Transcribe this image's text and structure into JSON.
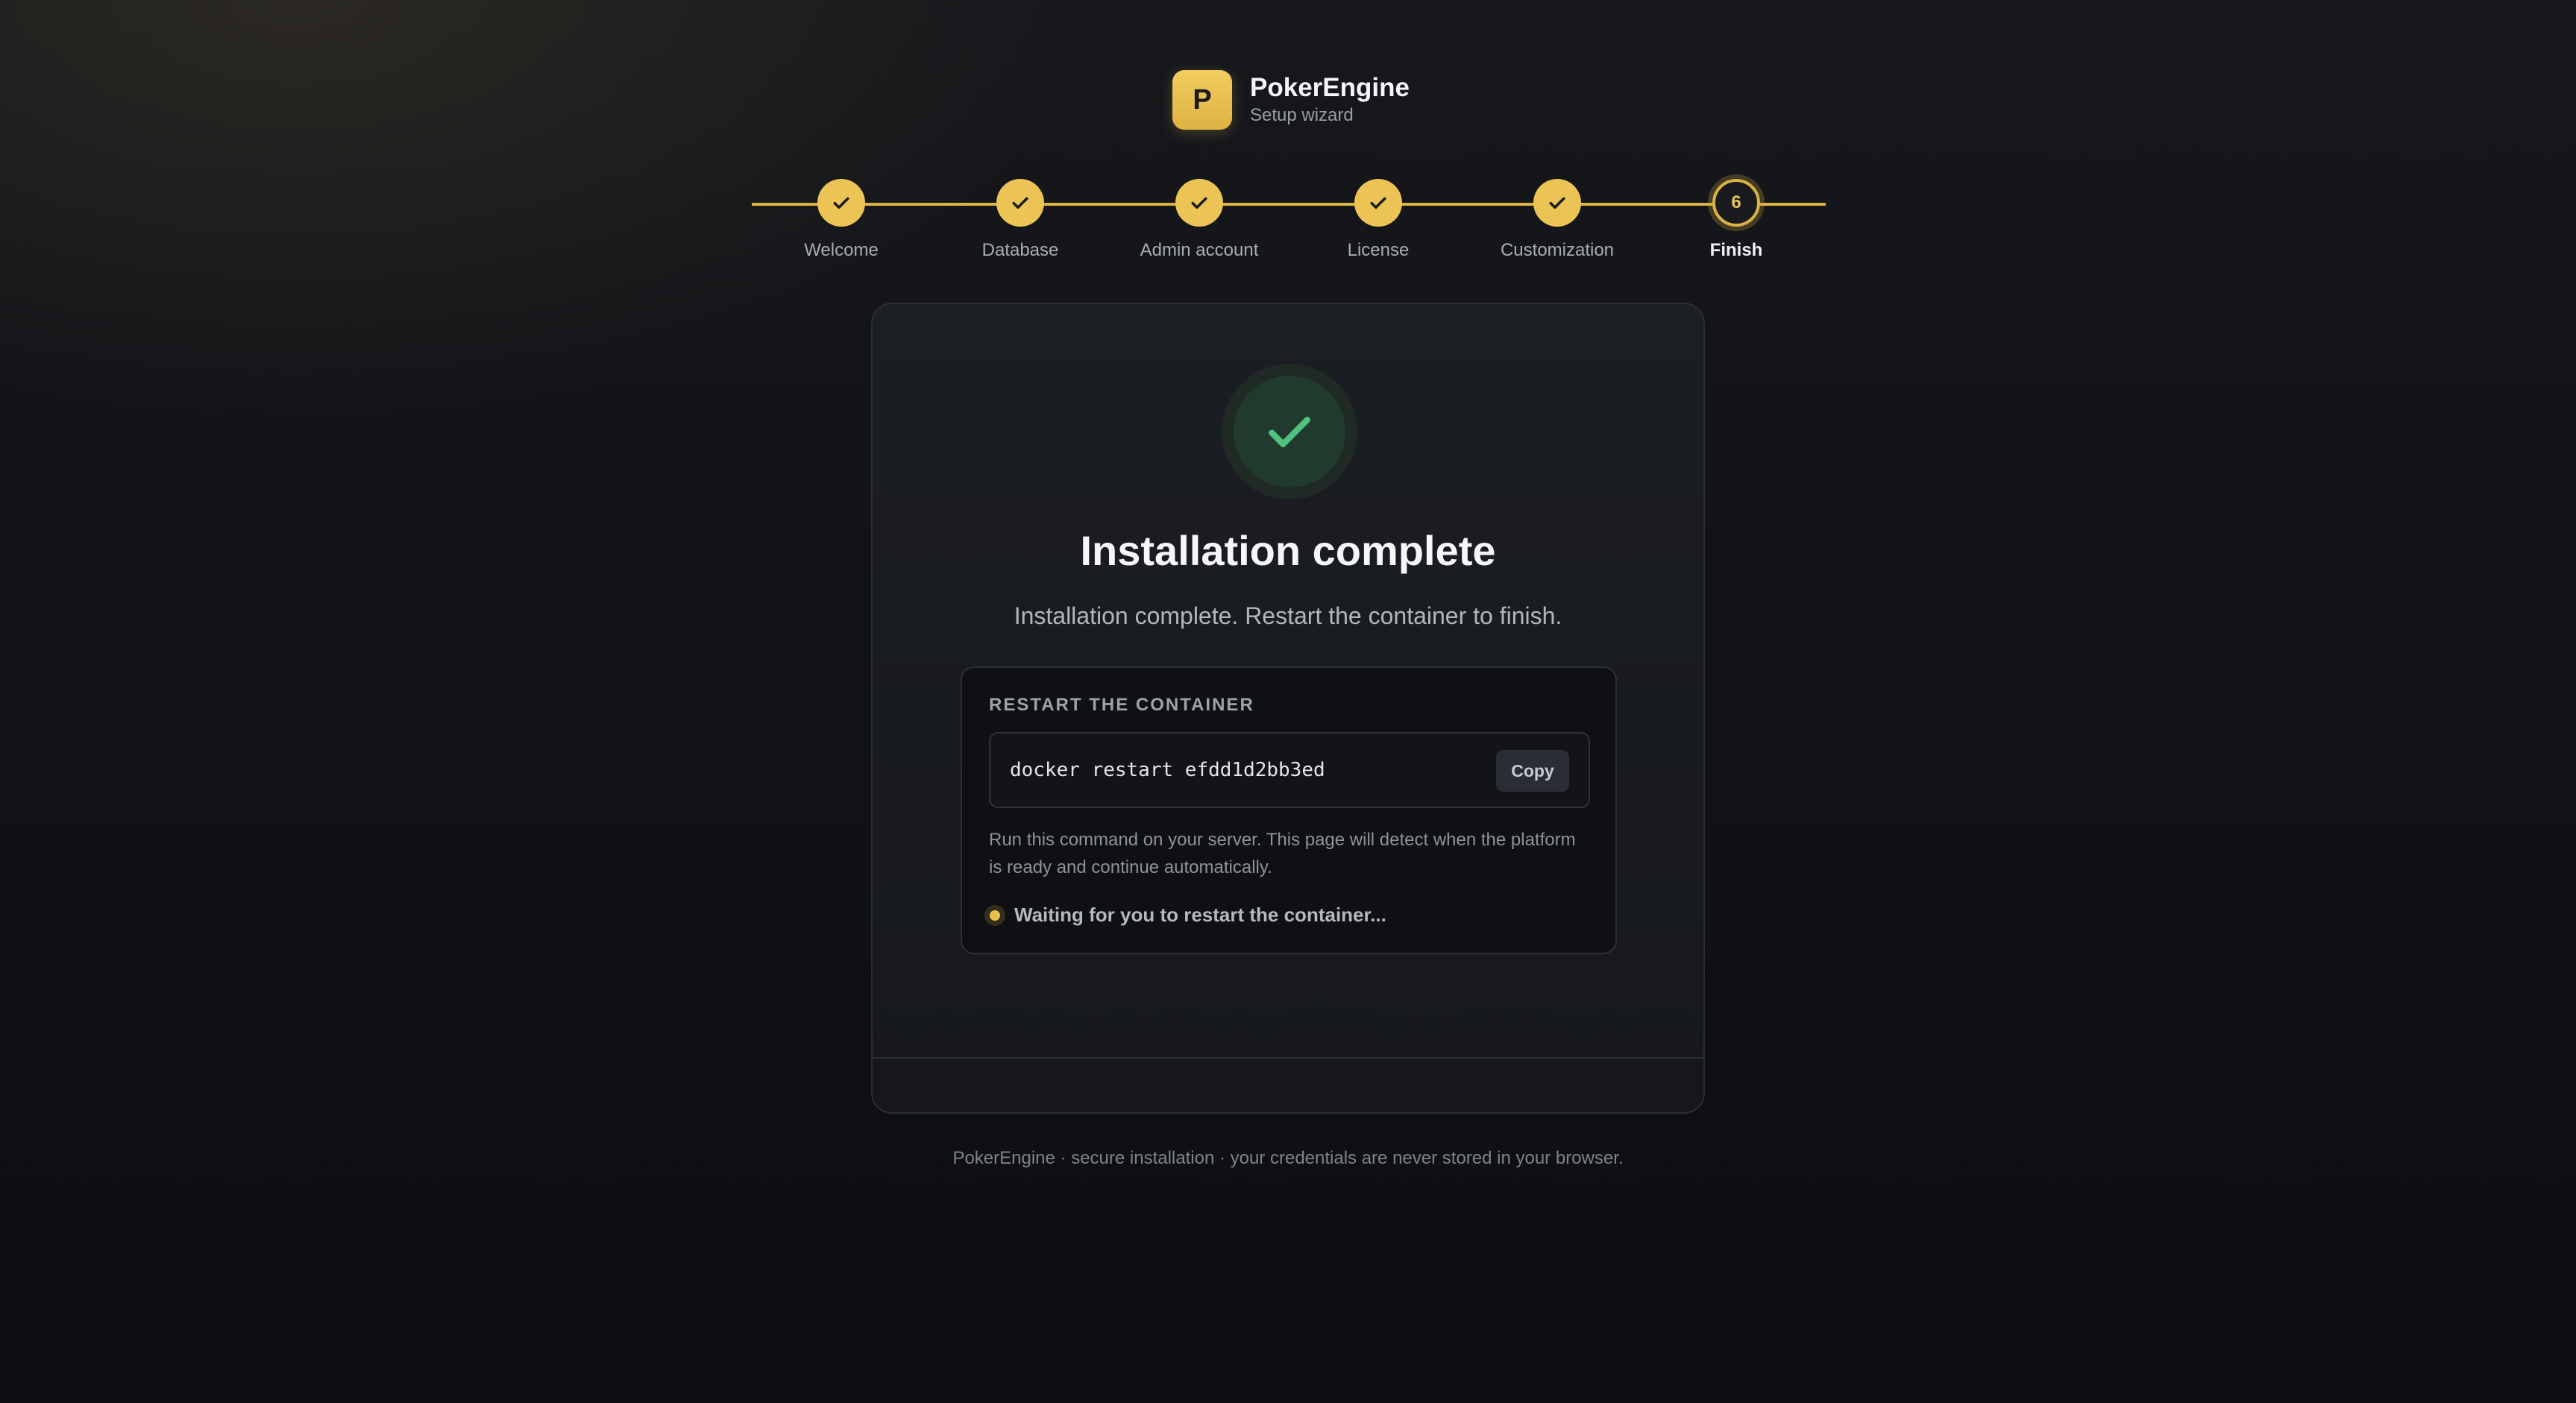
{
  "brand": {
    "logo_letter": "P",
    "name": "PokerEngine",
    "subtitle": "Setup wizard"
  },
  "stepper": {
    "steps": [
      {
        "label": "Welcome",
        "state": "done",
        "icon": "check-icon"
      },
      {
        "label": "Database",
        "state": "done",
        "icon": "check-icon"
      },
      {
        "label": "Admin account",
        "state": "done",
        "icon": "check-icon"
      },
      {
        "label": "License",
        "state": "done",
        "icon": "check-icon"
      },
      {
        "label": "Customization",
        "state": "done",
        "icon": "check-icon"
      },
      {
        "label": "Finish",
        "state": "current",
        "number": "6"
      }
    ]
  },
  "card": {
    "success_icon": "check-circle-icon",
    "title": "Installation complete",
    "subtitle": "Installation complete. Restart the container to finish.",
    "panel": {
      "heading": "RESTART THE CONTAINER",
      "command": "docker restart efdd1d2bb3ed",
      "copy_label": "Copy",
      "help_text": "Run this command on your server. This page will detect when the platform is ready and continue automatically.",
      "status_text": "Waiting for you to restart the container..."
    }
  },
  "footer": {
    "text": "PokerEngine · secure installation · your credentials are never stored in your browser."
  },
  "colors": {
    "accent": "#ecc455",
    "success": "#4ec27e",
    "background": "#111317"
  }
}
